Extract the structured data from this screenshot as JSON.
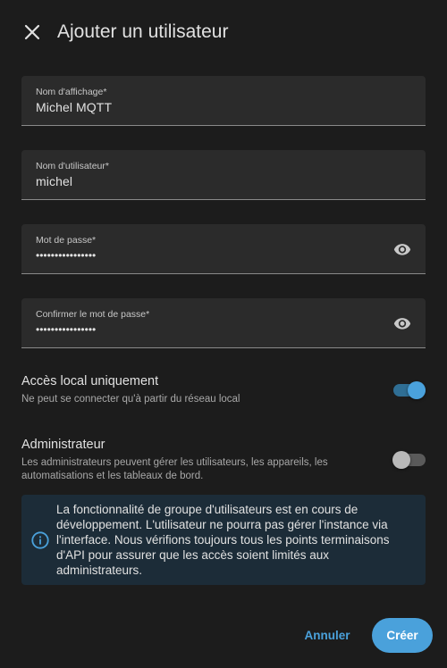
{
  "dialog": {
    "title": "Ajouter un utilisateur"
  },
  "fields": {
    "display_name": {
      "label": "Nom d'affichage*",
      "value": "Michel MQTT"
    },
    "username": {
      "label": "Nom d'utilisateur*",
      "value": "michel"
    },
    "password": {
      "label": "Mot de passe*",
      "value": "••••••••••••••••"
    },
    "confirm_password": {
      "label": "Confirmer le mot de passe*",
      "value": "••••••••••••••••"
    }
  },
  "settings": {
    "local_only": {
      "title": "Accès local uniquement",
      "description": "Ne peut se connecter qu'à partir du réseau local",
      "enabled": true
    },
    "admin": {
      "title": "Administrateur",
      "description": "Les administrateurs peuvent gérer les utilisateurs, les appareils, les automatisations et les tableaux de bord.",
      "enabled": false
    }
  },
  "alert": {
    "text": "La fonctionnalité de groupe d'utilisateurs est en cours de développement. L'utilisateur ne pourra pas gérer l'instance via l'interface. Nous vérifions toujours tous les points terminaisons d'API pour assurer que les accès soient limités aux administrateurs.",
    "icon": "info-icon"
  },
  "actions": {
    "cancel_label": "Annuler",
    "create_label": "Créer"
  },
  "colors": {
    "background": "#1c1c1c",
    "field_background": "#2b2b2b",
    "accent": "#4aa1db",
    "alert_background": "#1c2c38"
  }
}
